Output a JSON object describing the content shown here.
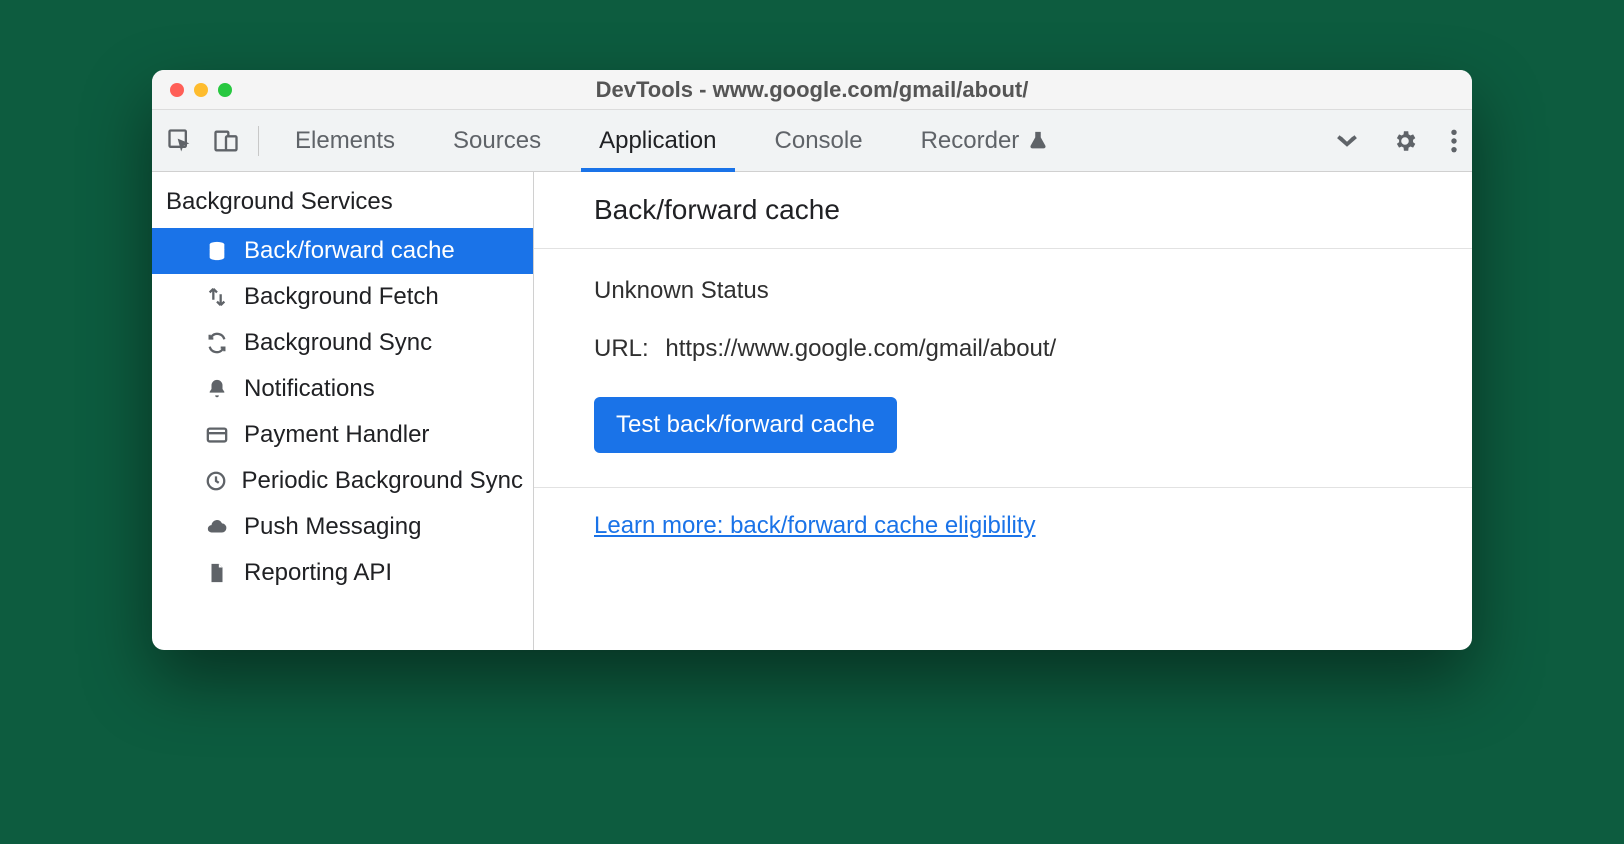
{
  "window": {
    "title": "DevTools - www.google.com/gmail/about/"
  },
  "tabs": {
    "elements": "Elements",
    "sources": "Sources",
    "application": "Application",
    "console": "Console",
    "recorder": "Recorder"
  },
  "sidebar": {
    "heading": "Background Services",
    "items": [
      {
        "label": "Back/forward cache",
        "icon": "database",
        "selected": true
      },
      {
        "label": "Background Fetch",
        "icon": "transfer",
        "selected": false
      },
      {
        "label": "Background Sync",
        "icon": "sync",
        "selected": false
      },
      {
        "label": "Notifications",
        "icon": "bell",
        "selected": false
      },
      {
        "label": "Payment Handler",
        "icon": "card",
        "selected": false
      },
      {
        "label": "Periodic Background Sync",
        "icon": "clock",
        "selected": false
      },
      {
        "label": "Push Messaging",
        "icon": "cloud",
        "selected": false
      },
      {
        "label": "Reporting API",
        "icon": "file",
        "selected": false
      }
    ]
  },
  "main": {
    "heading": "Back/forward cache",
    "status": "Unknown Status",
    "url_label": "URL:",
    "url_value": "https://www.google.com/gmail/about/",
    "test_button": "Test back/forward cache",
    "learn_more": "Learn more: back/forward cache eligibility"
  }
}
